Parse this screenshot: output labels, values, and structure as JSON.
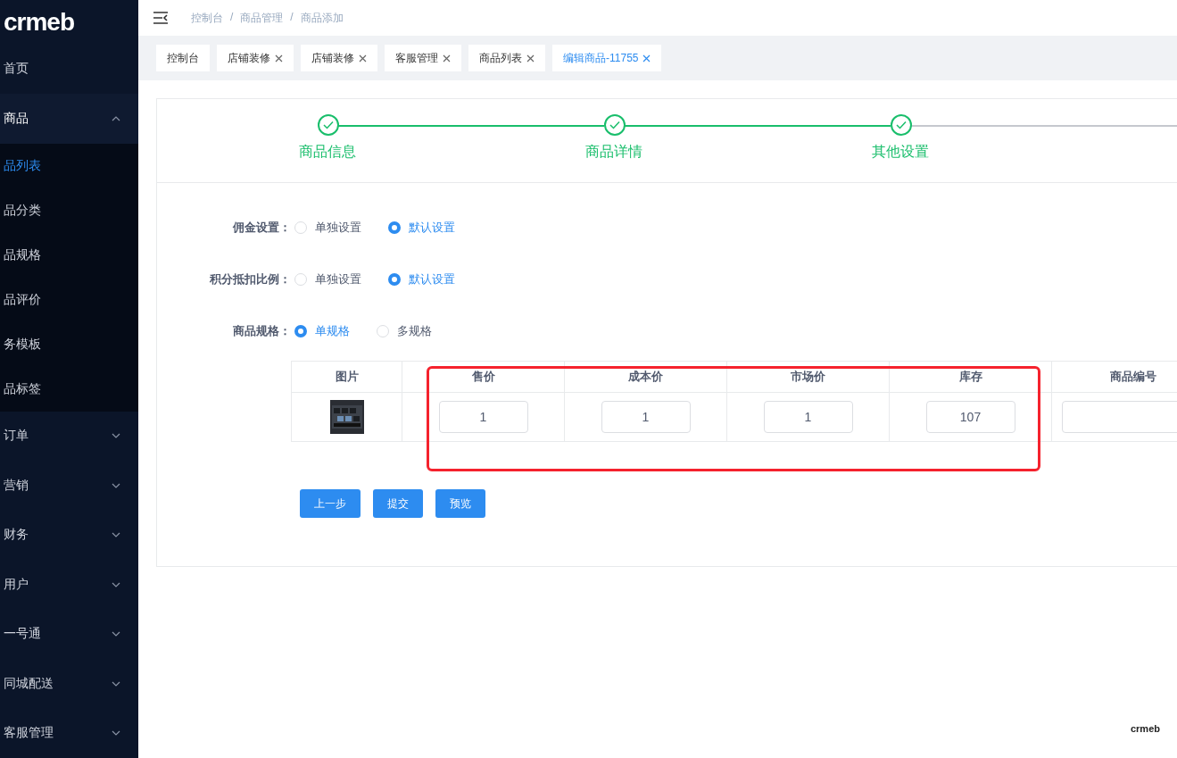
{
  "logo": "crmeb",
  "sidebar": {
    "items": [
      {
        "label": "首页",
        "expanded": false,
        "has_children": false
      },
      {
        "label": "商品",
        "expanded": true,
        "has_children": true,
        "children": [
          {
            "label": "品列表",
            "selected": true
          },
          {
            "label": "品分类",
            "selected": false
          },
          {
            "label": "品规格",
            "selected": false
          },
          {
            "label": "品评价",
            "selected": false
          },
          {
            "label": "务模板",
            "selected": false
          },
          {
            "label": "品标签",
            "selected": false
          }
        ]
      },
      {
        "label": "订单",
        "expanded": false,
        "has_children": true
      },
      {
        "label": "营销",
        "expanded": false,
        "has_children": true
      },
      {
        "label": "财务",
        "expanded": false,
        "has_children": true
      },
      {
        "label": "用户",
        "expanded": false,
        "has_children": true
      },
      {
        "label": "一号通",
        "expanded": false,
        "has_children": true
      },
      {
        "label": "同城配送",
        "expanded": false,
        "has_children": true
      },
      {
        "label": "客服管理",
        "expanded": false,
        "has_children": true
      }
    ]
  },
  "breadcrumb": {
    "separator": "/",
    "items": [
      "控制台",
      "商品管理",
      "商品添加"
    ]
  },
  "tabs": [
    {
      "label": "控制台",
      "selected": false,
      "closable": false
    },
    {
      "label": "店铺装修",
      "selected": false,
      "closable": true
    },
    {
      "label": "店铺装修",
      "selected": false,
      "closable": true
    },
    {
      "label": "客服管理",
      "selected": false,
      "closable": true
    },
    {
      "label": "商品列表",
      "selected": false,
      "closable": true
    },
    {
      "label": "编辑商品-11755",
      "selected": true,
      "closable": true
    }
  ],
  "steps": [
    {
      "label": "商品信息",
      "done": true
    },
    {
      "label": "商品详情",
      "done": true
    },
    {
      "label": "其他设置",
      "done": true
    }
  ],
  "form": [
    {
      "label": "佣金设置：",
      "options": [
        {
          "label": "单独设置",
          "selected": false
        },
        {
          "label": "默认设置",
          "selected": true
        }
      ]
    },
    {
      "label": "积分抵扣比例：",
      "options": [
        {
          "label": "单独设置",
          "selected": false
        },
        {
          "label": "默认设置",
          "selected": true
        }
      ]
    },
    {
      "label": "商品规格：",
      "options": [
        {
          "label": "单规格",
          "selected": true
        },
        {
          "label": "多规格",
          "selected": false
        }
      ]
    }
  ],
  "table": {
    "columns": [
      "图片",
      "售价",
      "成本价",
      "市场价",
      "库存",
      "商品编号"
    ],
    "rows": [
      {
        "image": {
          "kind": "picture"
        },
        "fields": [
          {
            "kind": "input",
            "value": "1"
          },
          {
            "kind": "input",
            "value": "1"
          },
          {
            "kind": "input",
            "value": "1"
          },
          {
            "kind": "input",
            "value": "107"
          },
          {
            "kind": "input"
          }
        ]
      }
    ]
  },
  "buttons": [
    "上一步",
    "提交",
    "预览"
  ],
  "footer_logo": "crmeb"
}
